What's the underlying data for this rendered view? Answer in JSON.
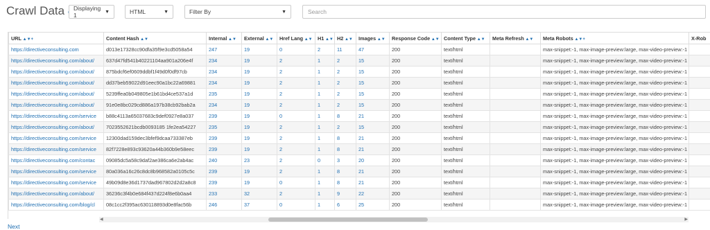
{
  "header": {
    "title": "Crawl Data",
    "displaying": "Displaying 1",
    "type_filter": "HTML",
    "filter_by": "Filter By",
    "search_placeholder": "Search"
  },
  "columns": [
    "URL",
    "Content Hash",
    "Internal",
    "External",
    "Href Lang",
    "H1",
    "H2",
    "Images",
    "Response Code",
    "Content Type",
    "Meta Refresh",
    "Meta Robots",
    "X-Rob"
  ],
  "rows": [
    [
      "https://directiveconsulting.com",
      "d013e17328cc90dfa35f9e3cd5058a54",
      "247",
      "19",
      "0",
      "2",
      "11",
      "47",
      "200",
      "text/html",
      "",
      "max-snippet:-1, max-image-preview:large, max-video-preview:-1",
      ""
    ],
    [
      "https://directiveconsulting.com/about/",
      "637d47fd541b40221104aa901a206e4f",
      "234",
      "19",
      "2",
      "1",
      "2",
      "15",
      "200",
      "text/html",
      "",
      "max-snippet:-1, max-image-preview:large, max-video-preview:-1",
      ""
    ],
    [
      "https://directiveconsulting.com/about/",
      "875bdcf6ef0609ddbf1f49d0f0df97cb",
      "234",
      "19",
      "2",
      "1",
      "2",
      "15",
      "200",
      "text/html",
      "",
      "max-snippet:-1, max-image-preview:large, max-video-preview:-1",
      ""
    ],
    [
      "https://directiveconsulting.com/about/",
      "dd37beb59022d91eec90a1bc22a69881",
      "234",
      "19",
      "2",
      "1",
      "2",
      "15",
      "200",
      "text/html",
      "",
      "max-snippet:-1, max-image-preview:large, max-video-preview:-1",
      ""
    ],
    [
      "https://directiveconsulting.com/about/",
      "5239ffea0b049805e1b61bd4ce537a1d",
      "235",
      "19",
      "2",
      "1",
      "2",
      "15",
      "200",
      "text/html",
      "",
      "max-snippet:-1, max-image-preview:large, max-video-preview:-1",
      ""
    ],
    [
      "https://directiveconsulting.com/about/",
      "91e0e8bc029cd886a197b38cb92bab2a",
      "234",
      "19",
      "2",
      "1",
      "2",
      "15",
      "200",
      "text/html",
      "",
      "max-snippet:-1, max-image-preview:large, max-video-preview:-1",
      ""
    ],
    [
      "https://directiveconsulting.com/service",
      "b88c4113a65037683c9def0927e8a037",
      "239",
      "19",
      "0",
      "1",
      "8",
      "21",
      "200",
      "text/html",
      "",
      "max-snippet:-1, max-image-preview:large, max-video-preview:-1",
      ""
    ],
    [
      "https://directiveconsulting.com/about/",
      "7023552621bcdb0093185 1fe2ea54227",
      "235",
      "19",
      "2",
      "1",
      "2",
      "15",
      "200",
      "text/html",
      "",
      "max-snippet:-1, max-image-preview:large, max-video-preview:-1",
      ""
    ],
    [
      "https://directiveconsulting.com/service",
      "12300dad159dec3bfef9dcaa733387eb",
      "239",
      "19",
      "2",
      "1",
      "8",
      "21",
      "200",
      "text/html",
      "",
      "max-snippet:-1, max-image-preview:large, max-video-preview:-1",
      ""
    ],
    [
      "https://directiveconsulting.com/service",
      "82f7228e893c93620a44b360b9e58eec",
      "239",
      "19",
      "2",
      "1",
      "8",
      "21",
      "200",
      "text/html",
      "",
      "max-snippet:-1, max-image-preview:large, max-video-preview:-1",
      ""
    ],
    [
      "https://directiveconsulting.com/contac",
      "09085dc5a58c9daf2ae386ca6e2ab4ac",
      "240",
      "23",
      "2",
      "0",
      "3",
      "20",
      "200",
      "text/html",
      "",
      "max-snippet:-1, max-image-preview:large, max-video-preview:-1",
      ""
    ],
    [
      "https://directiveconsulting.com/service",
      "80a036a16c26c8dc8b968582a0105c5c",
      "239",
      "19",
      "2",
      "1",
      "8",
      "21",
      "200",
      "text/html",
      "",
      "max-snippet:-1, max-image-preview:large, max-video-preview:-1",
      ""
    ],
    [
      "https://directiveconsulting.com/service",
      "49b09d8e36d1737dad967802d2d2a8c8",
      "239",
      "19",
      "0",
      "1",
      "8",
      "21",
      "200",
      "text/html",
      "",
      "max-snippet:-1, max-image-preview:large, max-video-preview:-1",
      ""
    ],
    [
      "https://directiveconsulting.com/about/",
      "36236c3f4b0e684f437d224f8e6b0aa4",
      "233",
      "32",
      "2",
      "1",
      "9",
      "22",
      "200",
      "text/html",
      "",
      "max-snippet:-1, max-image-preview:large, max-video-preview:-1",
      ""
    ],
    [
      "https://directiveconsulting.com/blog/cl",
      "08c1cc2f395ac630118893d0e8fac56b",
      "246",
      "37",
      "0",
      "1",
      "6",
      "25",
      "200",
      "text/html",
      "",
      "max-snippet:-1, max-image-preview:large, max-video-preview:-1",
      ""
    ]
  ],
  "pager": {
    "next_label": "Next"
  },
  "colors": {
    "link": "#1f6fb2",
    "stripe": "#f5f5f5",
    "border": "#dddddd"
  }
}
